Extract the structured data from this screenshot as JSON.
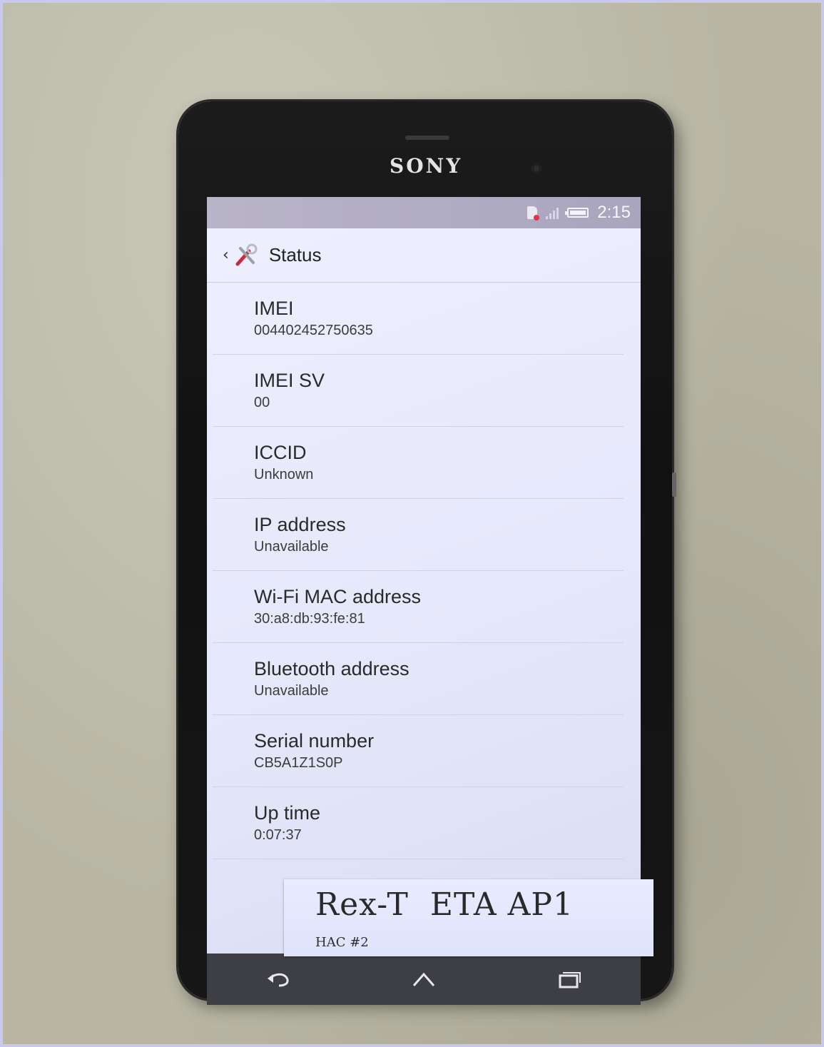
{
  "device": {
    "brand": "SONY"
  },
  "status_bar": {
    "time": "2:15",
    "icons": [
      "sim-card-icon",
      "signal-icon",
      "battery-icon"
    ]
  },
  "action_bar": {
    "title": "Status",
    "back_icon": "chevron-left-icon",
    "app_icon": "settings-tools-icon"
  },
  "items": [
    {
      "label": "IMEI",
      "value": "004402452750635"
    },
    {
      "label": "IMEI SV",
      "value": "00"
    },
    {
      "label": "ICCID",
      "value": "Unknown"
    },
    {
      "label": "IP address",
      "value": "Unavailable"
    },
    {
      "label": "Wi-Fi MAC address",
      "value": "30:a8:db:93:fe:81"
    },
    {
      "label": "Bluetooth address",
      "value": "Unavailable"
    },
    {
      "label": "Serial number",
      "value": "CB5A1Z1S0P"
    },
    {
      "label": "Up time",
      "value": "0:07:37"
    }
  ],
  "nav_bar": {
    "icons": [
      "back-icon",
      "home-icon",
      "recents-icon"
    ]
  },
  "sticker": {
    "main": "Rex-T  ETA AP1",
    "sub": "HAC #2"
  },
  "colors": {
    "screen_bg": "#e6e8fb",
    "status_bar_bg": "#b9b4c8",
    "nav_bar_bg": "#3d3f44",
    "alert_red": "#e0324a"
  }
}
